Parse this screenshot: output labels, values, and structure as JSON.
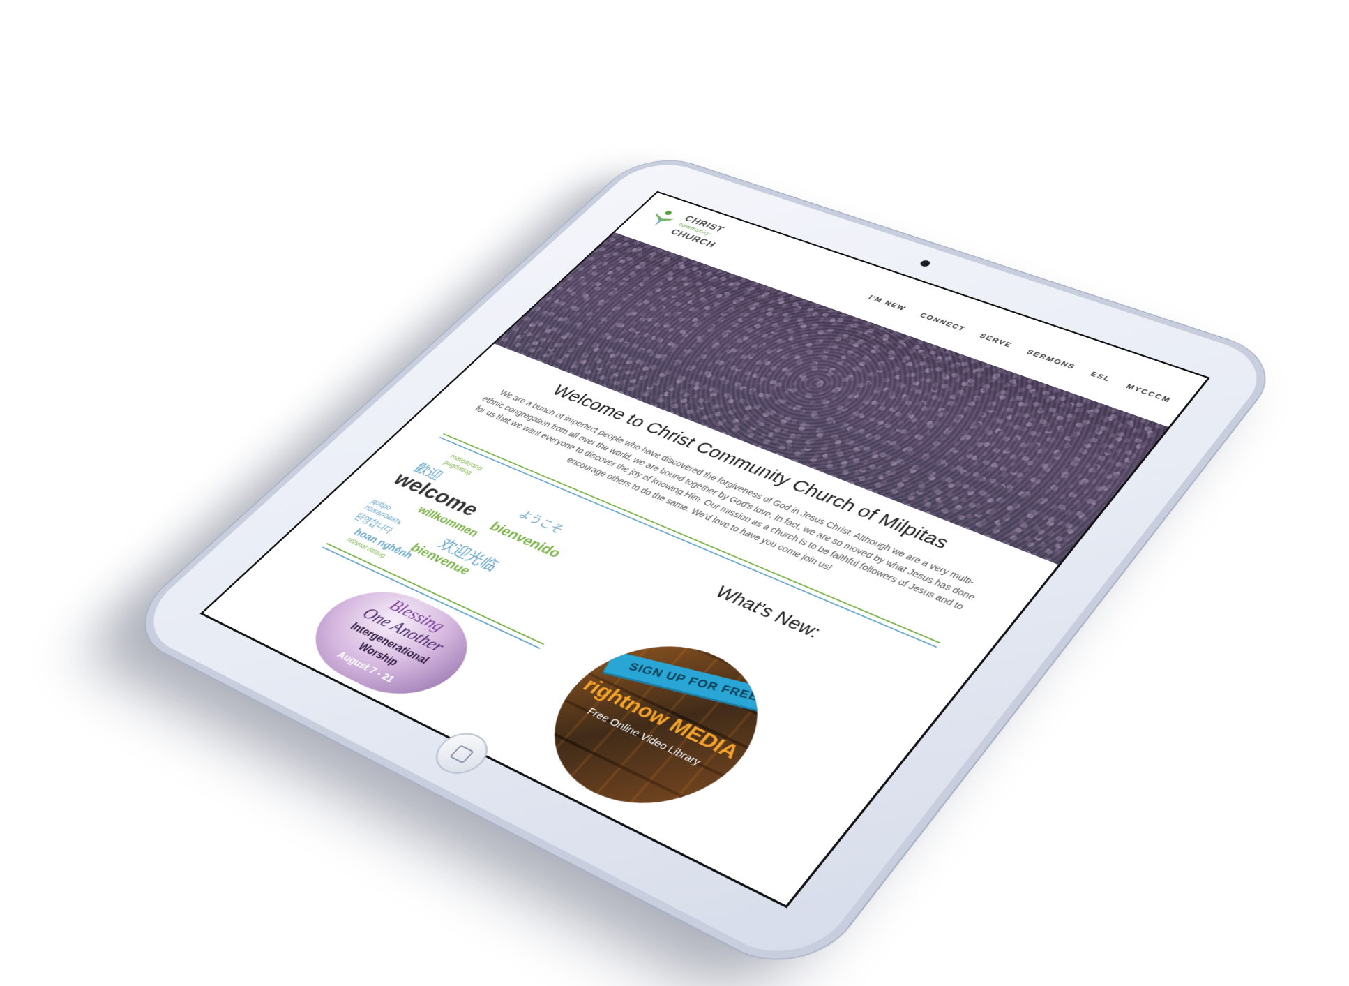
{
  "site": {
    "logo": {
      "line1": "CHRIST",
      "line2": "community",
      "line3": "CHURCH"
    },
    "nav": [
      {
        "label": "I'M NEW"
      },
      {
        "label": "CONNECT"
      },
      {
        "label": "SERVE"
      },
      {
        "label": "SERMONS"
      },
      {
        "label": "ESL"
      },
      {
        "label": "MYCCCM"
      }
    ]
  },
  "welcome": {
    "title": "Welcome to Christ Community Church of Milpitas",
    "body": "We are a bunch of imperfect people who have discovered the forgiveness of God in Jesus Christ. Although we are a very multi-ethnic congregation from all over the world, we are bound together by God's love. In fact, we are so moved by what Jesus has done for us that we want everyone to discover the joy of knowing Him. Our mission as a church is to be faithful followers of Jesus and to encourage others to do the same. We'd love to have you come join us!"
  },
  "word_cloud": {
    "words": [
      {
        "text": "maligayang",
        "color": "#7bb34a"
      },
      {
        "text": "pagdating",
        "color": "#7bb34a"
      },
      {
        "text": "歡迎",
        "color": "#6ca9c9"
      },
      {
        "text": "ようこそ",
        "color": "#6ca9c9"
      },
      {
        "text": "welcome",
        "color": "#333333"
      },
      {
        "text": "willkommen",
        "color": "#7bb34a"
      },
      {
        "text": "bienvenido",
        "color": "#7bb34a"
      },
      {
        "text": "добро",
        "color": "#6ca9c9"
      },
      {
        "text": "пожаловать",
        "color": "#6ca9c9"
      },
      {
        "text": "환영합니다",
        "color": "#6ca9c9"
      },
      {
        "text": "欢迎光临",
        "color": "#6ca9c9"
      },
      {
        "text": "bienvenue",
        "color": "#7bb34a"
      },
      {
        "text": "hoan nghênh",
        "color": "#6ca9c9"
      },
      {
        "text": "selamat datang",
        "color": "#7bb34a"
      }
    ]
  },
  "whats_new": {
    "title": "What's New:"
  },
  "promos": {
    "blessing": {
      "line1": "Blessing",
      "line2": "One Another",
      "line3": "Intergenerational",
      "line4": "Worship",
      "line5": "August 7 - 21"
    },
    "rightnow": {
      "ribbon": "SIGN UP FOR FREE!",
      "brand": "rightnow MEDIA",
      "subtitle": "Free Online Video Library"
    }
  },
  "colors": {
    "accent_green": "#7bb34a",
    "accent_blue": "#6ca9c9",
    "ribbon_blue": "#29a6d6",
    "brand_orange": "#f4a32c"
  }
}
